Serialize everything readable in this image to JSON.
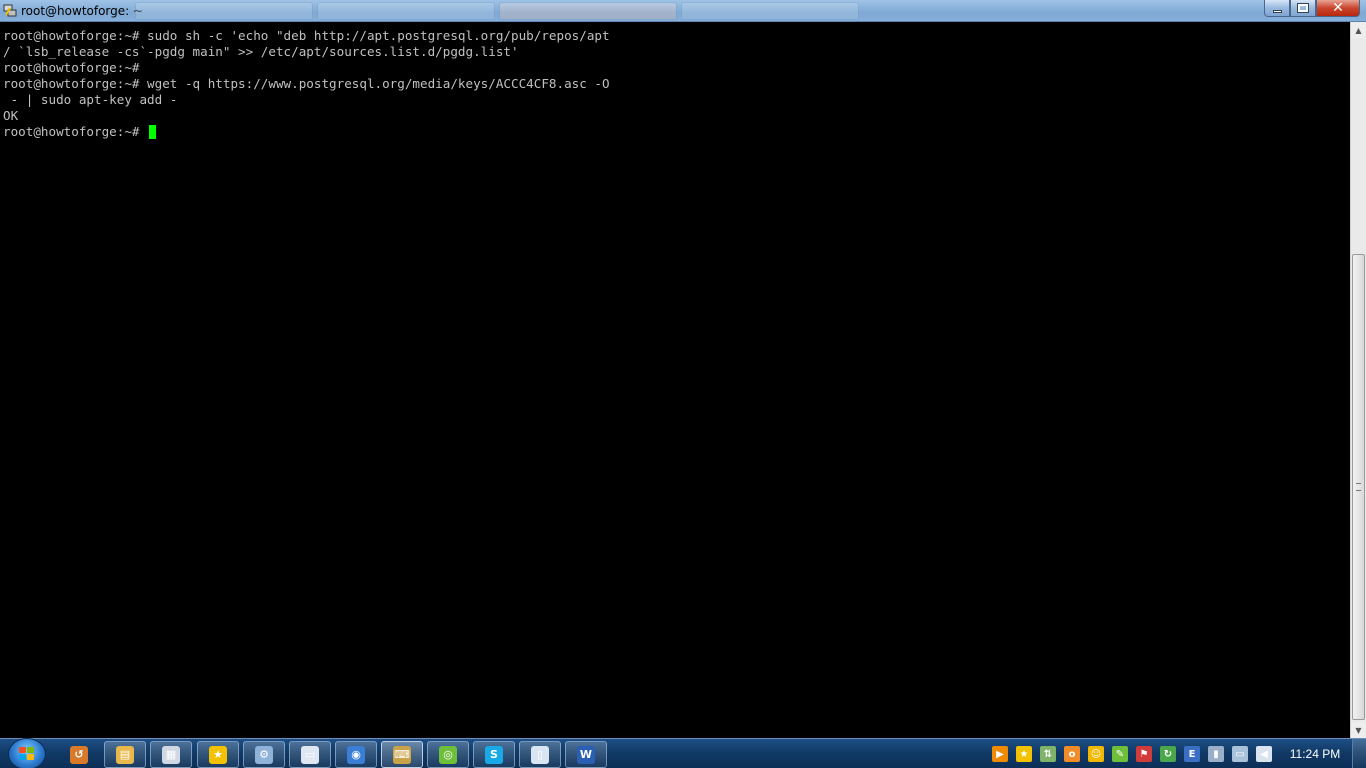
{
  "window": {
    "title": "root@howtoforge: ~",
    "app_icon": "putty-icon",
    "controls": {
      "minimize_icon": "minimize-icon",
      "maximize_icon": "maximize-icon",
      "close_icon": "close-icon"
    }
  },
  "terminal": {
    "lines": [
      "root@howtoforge:~# sudo sh -c 'echo \"deb http://apt.postgresql.org/pub/repos/apt",
      "/ `lsb_release -cs`-pgdg main\" >> /etc/apt/sources.list.d/pgdg.list'",
      "root@howtoforge:~#",
      "root@howtoforge:~# wget -q https://www.postgresql.org/media/keys/ACCC4CF8.asc -O",
      " - | sudo apt-key add -",
      "OK"
    ],
    "prompt": "root@howtoforge:~# ",
    "cursor_color": "#00ff00",
    "text_color": "#c0c0c0",
    "background": "#000000"
  },
  "taskbar": {
    "start_icon": "windows-start-icon",
    "pinned": [
      {
        "name": "app-icon-1",
        "glyph": "↺",
        "color": "#d97a2b"
      },
      {
        "name": "explorer-icon",
        "glyph": "▤",
        "color": "#e8b84a"
      },
      {
        "name": "calculator-icon",
        "glyph": "▦",
        "color": "#cfd8e3"
      },
      {
        "name": "favorites-icon",
        "glyph": "★",
        "color": "#f2c200"
      },
      {
        "name": "network-icon",
        "glyph": "⚙",
        "color": "#8fb2d9"
      },
      {
        "name": "notepad-icon",
        "glyph": "▭",
        "color": "#dfe8f2"
      },
      {
        "name": "browser-icon",
        "glyph": "◉",
        "color": "#3a7fd5"
      },
      {
        "name": "putty-icon",
        "glyph": "⌨",
        "color": "#c9a34a"
      },
      {
        "name": "green-app-icon",
        "glyph": "◎",
        "color": "#6fbf3a"
      },
      {
        "name": "skype-icon",
        "glyph": "S",
        "color": "#18a9e6"
      },
      {
        "name": "document-icon",
        "glyph": "▯",
        "color": "#d8e6f3"
      },
      {
        "name": "word-icon",
        "glyph": "W",
        "color": "#2b5fb4"
      }
    ],
    "tray": [
      {
        "name": "media-icon",
        "glyph": "▶",
        "color": "#f08a00"
      },
      {
        "name": "star-tray-icon",
        "glyph": "★",
        "color": "#f2c200"
      },
      {
        "name": "network-tray-icon",
        "glyph": "⇅",
        "color": "#7fb36a"
      },
      {
        "name": "orange-tray-icon",
        "glyph": "o",
        "color": "#f28c28"
      },
      {
        "name": "smiley-tray-icon",
        "glyph": "☺",
        "color": "#f2b800"
      },
      {
        "name": "sync-tray-icon",
        "glyph": "✎",
        "color": "#6fbf3a"
      },
      {
        "name": "flag-tray-icon",
        "glyph": "⚑",
        "color": "#d23b3b"
      },
      {
        "name": "update-tray-icon",
        "glyph": "↻",
        "color": "#4aa84a"
      },
      {
        "name": "e-tray-icon",
        "glyph": "E",
        "color": "#3b6fc4"
      },
      {
        "name": "device-tray-icon",
        "glyph": "▮",
        "color": "#9ab0c8"
      },
      {
        "name": "monitor-tray-icon",
        "glyph": "▭",
        "color": "#a9c1da"
      },
      {
        "name": "volume-tray-icon",
        "glyph": "◀",
        "color": "#d9e4ef"
      }
    ],
    "clock": "11:24 PM"
  }
}
